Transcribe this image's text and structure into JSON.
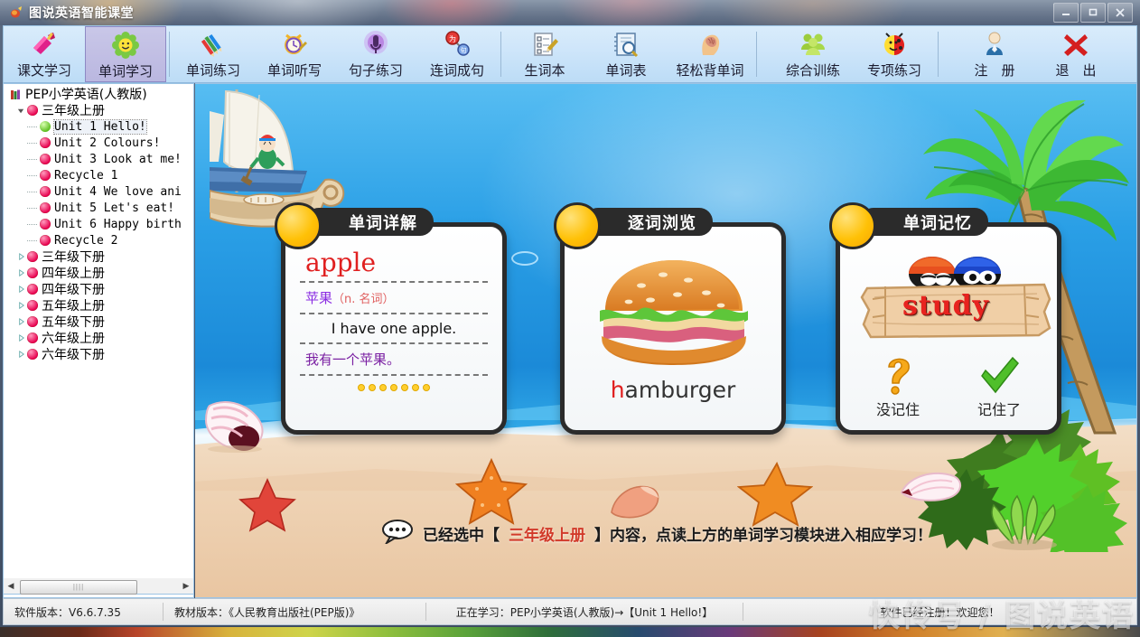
{
  "window": {
    "title": "图说英语智能课堂",
    "icon": "app-icon",
    "controls": {
      "minimize": "—",
      "maximize": "❐",
      "close": "✕"
    }
  },
  "toolbar": {
    "items": [
      {
        "label": "课文学习",
        "icon": "book-pen-icon",
        "active": false
      },
      {
        "label": "单词学习",
        "icon": "flower-smile-icon",
        "active": true
      },
      {
        "label": "单词练习",
        "icon": "color-pencils-icon",
        "active": false
      },
      {
        "label": "单词听写",
        "icon": "alarm-clock-pencil-icon",
        "active": false
      },
      {
        "label": "句子练习",
        "icon": "microphone-icon",
        "active": false
      },
      {
        "label": "连词成句",
        "icon": "link-balls-icon",
        "active": false
      },
      {
        "label": "生词本",
        "icon": "checklist-pencil-icon",
        "active": false
      },
      {
        "label": "单词表",
        "icon": "notebook-magnifier-icon",
        "active": false
      },
      {
        "label": "轻松背单词",
        "icon": "brain-head-icon",
        "active": false
      },
      {
        "label": "综合训练",
        "icon": "group-people-icon",
        "active": false
      },
      {
        "label": "专项练习",
        "icon": "ladybug-smile-icon",
        "active": false
      },
      {
        "label": "注　册",
        "icon": "user-person-icon",
        "active": false
      },
      {
        "label": "退　出",
        "icon": "red-cross-icon",
        "active": false
      }
    ],
    "separator_after": [
      1,
      5,
      8,
      10
    ]
  },
  "sidebar": {
    "root": {
      "label": "PEP小学英语(人教版)",
      "icon": "book-stack-icon"
    },
    "grades": [
      {
        "label": "三年级上册",
        "expanded": true,
        "bullet": "red",
        "units": [
          {
            "label": "Unit 1 Hello!",
            "bullet": "green",
            "selected": true
          },
          {
            "label": "Unit 2 Colours!",
            "bullet": "red",
            "selected": false
          },
          {
            "label": "Unit 3 Look at me!",
            "bullet": "red",
            "selected": false
          },
          {
            "label": "Recycle 1",
            "bullet": "red",
            "selected": false
          },
          {
            "label": "Unit 4 We love ani",
            "bullet": "red",
            "selected": false
          },
          {
            "label": "Unit 5 Let's eat!",
            "bullet": "red",
            "selected": false
          },
          {
            "label": "Unit 6 Happy birth",
            "bullet": "red",
            "selected": false
          },
          {
            "label": "Recycle 2",
            "bullet": "red",
            "selected": false
          }
        ]
      },
      {
        "label": "三年级下册",
        "expanded": false,
        "bullet": "red",
        "units": []
      },
      {
        "label": "四年级上册",
        "expanded": false,
        "bullet": "red",
        "units": []
      },
      {
        "label": "四年级下册",
        "expanded": false,
        "bullet": "red",
        "units": []
      },
      {
        "label": "五年级上册",
        "expanded": false,
        "bullet": "red",
        "units": []
      },
      {
        "label": "五年级下册",
        "expanded": false,
        "bullet": "red",
        "units": []
      },
      {
        "label": "六年级上册",
        "expanded": false,
        "bullet": "red",
        "units": []
      },
      {
        "label": "六年级下册",
        "expanded": false,
        "bullet": "red",
        "units": []
      }
    ],
    "scrollbar": {
      "left_arrow": "◀",
      "right_arrow": "▶",
      "thumb": "||||"
    }
  },
  "cards": {
    "detail": {
      "title": "单词详解",
      "word_en": "apple",
      "word_cn": "苹果",
      "pos": "（n. 名词）",
      "sentence_en": "I have one apple.",
      "sentence_cn": "我有一个苹果。",
      "dots": 7
    },
    "browse": {
      "title": "逐词浏览",
      "image": "hamburger-image",
      "word_first": "h",
      "word_rest": "amburger"
    },
    "memory": {
      "title": "单词记忆",
      "word": "study",
      "image": "wooden-plank-image",
      "bugs": "two-ladybugs-icon",
      "options": [
        {
          "label": "没记住",
          "icon": "question-mark-icon"
        },
        {
          "label": "记住了",
          "icon": "green-check-icon"
        }
      ]
    }
  },
  "hint": {
    "icon": "speech-bubble-icon",
    "prefix": "已经选中【",
    "grade": "三年级上册",
    "suffix": "】内容，点读上方的单词学习模块进入相应学习！"
  },
  "status": {
    "software_version": "软件版本：V6.6.7.35",
    "textbook_version": "教材版本：《人民教育出版社(PEP版)》",
    "learning": "正在学习：PEP小学英语(人教版)→【Unit 1 Hello!】",
    "registration": "软件已经注册！欢迎您！"
  },
  "watermark": "快传号 / 图说英语",
  "colors": {
    "accent": "#e02020",
    "card_border": "#2b2b2b",
    "coin": "#ffc107",
    "sea": "#1b8ad8",
    "sand": "#efd4b6",
    "active_tab": "#bab7e0"
  }
}
